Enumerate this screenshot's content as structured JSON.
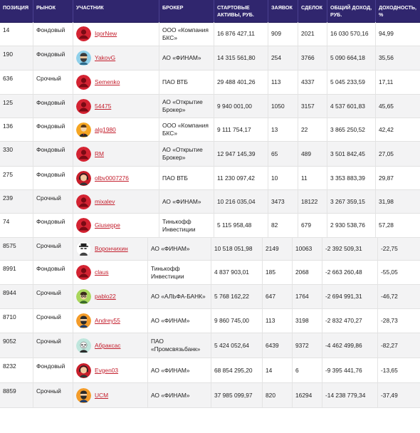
{
  "table": {
    "headers": {
      "position": "ПОЗИЦИЯ",
      "market": "РЫНОК",
      "participant": "УЧАСТНИК",
      "broker": "БРОКЕР",
      "assets": "СТАРТОВЫЕ АКТИВЫ, РУБ.",
      "orders": "ЗАЯВОК",
      "deals": "СДЕЛОК",
      "income": "ОБЩИЙ ДОХОД, РУБ.",
      "yield": "ДОХОДНОСТЬ, %"
    },
    "rows": [
      {
        "position": "14",
        "market": "Фондовый",
        "user": "IqorNew",
        "avatar": "red-default-avatar-icon",
        "broker": "ООО «Компания БКС»",
        "assets": "16 876 427,11",
        "orders": "909",
        "deals": "2021",
        "income": "16 030 570,16",
        "yield": "94,99"
      },
      {
        "position": "190",
        "market": "Фондовый",
        "user": "YakovG",
        "avatar": "blue-bearded-avatar-icon",
        "broker": "АО «ФИНАМ»",
        "assets": "14 315 561,80",
        "orders": "254",
        "deals": "3766",
        "income": "5 090 664,18",
        "yield": "35,56"
      },
      {
        "position": "636",
        "market": "Срочный",
        "user": "Semenko",
        "avatar": "red-default-avatar-icon",
        "broker": "ПАО ВТБ",
        "assets": "29 488 401,26",
        "orders": "113",
        "deals": "4337",
        "income": "5 045 233,59",
        "yield": "17,11"
      },
      {
        "position": "125",
        "market": "Фондовый",
        "user": "54475",
        "avatar": "red-default-avatar-icon",
        "broker": "АО «Открытие Брокер»",
        "assets": "9 940 001,00",
        "orders": "1050",
        "deals": "3157",
        "income": "4 537 601,83",
        "yield": "45,65"
      },
      {
        "position": "136",
        "market": "Фондовый",
        "user": "alg1980",
        "avatar": "orange-suit-avatar-icon",
        "broker": "ООО «Компания БКС»",
        "assets": "9 111 754,17",
        "orders": "13",
        "deals": "22",
        "income": "3 865 250,52",
        "yield": "42,42"
      },
      {
        "position": "330",
        "market": "Фондовый",
        "user": "RM",
        "avatar": "red-default-avatar-icon",
        "broker": "АО «Открытие Брокер»",
        "assets": "12 947 145,39",
        "orders": "65",
        "deals": "489",
        "income": "3 501 842,45",
        "yield": "27,05"
      },
      {
        "position": "275",
        "market": "Фондовый",
        "user": "olbv0007276",
        "avatar": "red-headphones-avatar-icon",
        "broker": "ПАО ВТБ",
        "assets": "11 230 097,42",
        "orders": "10",
        "deals": "11",
        "income": "3 353 883,39",
        "yield": "29,87"
      },
      {
        "position": "239",
        "market": "Срочный",
        "user": "mixalev",
        "avatar": "red-default-avatar-icon",
        "broker": "АО «ФИНАМ»",
        "assets": "10 216 035,04",
        "orders": "3473",
        "deals": "18122",
        "income": "3 267 359,15",
        "yield": "31,98"
      },
      {
        "position": "74",
        "market": "Фондовый",
        "user": "Giuseppe",
        "avatar": "red-default-avatar-icon",
        "broker": "Тинькофф Инвестиции",
        "assets": "5 115 958,48",
        "orders": "82",
        "deals": "679",
        "income": "2 930 538,76",
        "yield": "57,28"
      },
      {
        "position": "8575",
        "market": "Срочный",
        "user": "Ворончихин",
        "avatar": "white-hat-avatar-icon",
        "broker": "АО «ФИНАМ»",
        "assets": "10 518 051,98",
        "orders": "2149",
        "deals": "10063",
        "income": "-2 392 509,31",
        "yield": "-22,75"
      },
      {
        "position": "8991",
        "market": "Фондовый",
        "user": "claus",
        "avatar": "red-default-avatar-icon",
        "broker": "Тинькофф Инвестиции",
        "assets": "4 837 903,01",
        "orders": "185",
        "deals": "2068",
        "income": "-2 663 260,48",
        "yield": "-55,05"
      },
      {
        "position": "8944",
        "market": "Срочный",
        "user": "pablo22",
        "avatar": "green-glasses-avatar-icon",
        "broker": "АО «АЛЬФА-БАНК»",
        "assets": "5 768 162,22",
        "orders": "647",
        "deals": "1764",
        "income": "-2 694 991,31",
        "yield": "-46,72"
      },
      {
        "position": "8710",
        "market": "Срочный",
        "user": "Andrey55",
        "avatar": "orange-bearded-avatar-icon",
        "broker": "АО «ФИНАМ»",
        "assets": "9 860 745,00",
        "orders": "113",
        "deals": "3198",
        "income": "-2 832 470,27",
        "yield": "-28,73"
      },
      {
        "position": "9052",
        "market": "Срочный",
        "user": "Абраксас",
        "avatar": "teal-masked-avatar-icon",
        "broker": "ПАО «Промсвязьбанк»",
        "assets": "5 424 052,64",
        "orders": "6439",
        "deals": "9372",
        "income": "-4 462 499,86",
        "yield": "-82,27"
      },
      {
        "position": "8232",
        "market": "Фондовый",
        "user": "Evgen03",
        "avatar": "red-headphones-avatar-icon",
        "broker": "АО «ФИНАМ»",
        "assets": "68 854 295,20",
        "orders": "14",
        "deals": "6",
        "income": "-9 395 441,76",
        "yield": "-13,65"
      },
      {
        "position": "8859",
        "market": "Срочный",
        "user": "UCM",
        "avatar": "orange-bearded-avatar-icon",
        "broker": "АО «ФИНАМ»",
        "assets": "37 985 099,97",
        "orders": "820",
        "deals": "16294",
        "income": "-14 238 779,34",
        "yield": "-37,49"
      }
    ]
  }
}
